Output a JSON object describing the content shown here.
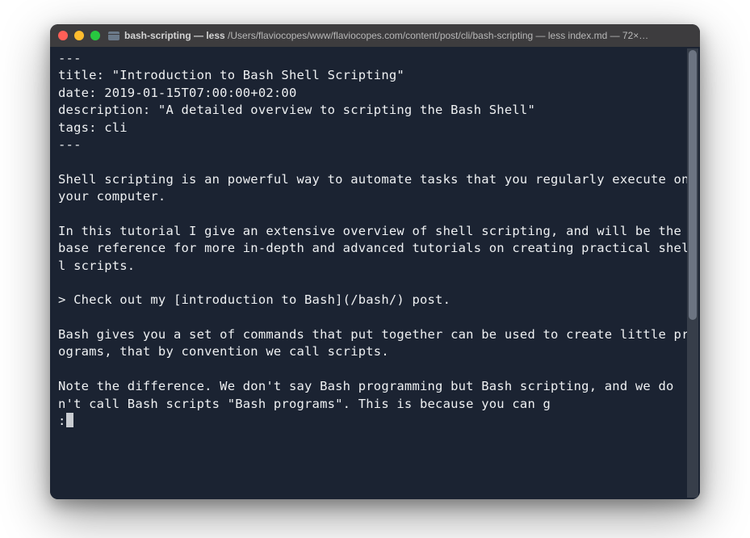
{
  "titlebar": {
    "process": "bash-scripting — less",
    "path": "/Users/flaviocopes/www/flaviocopes.com/content/post/cli/bash-scripting — less index.md — 72×…"
  },
  "content": {
    "lines": [
      "---",
      "title: \"Introduction to Bash Shell Scripting\"",
      "date: 2019-01-15T07:00:00+02:00",
      "description: \"A detailed overview to scripting the Bash Shell\"",
      "tags: cli",
      "---",
      "",
      "Shell scripting is an powerful way to automate tasks that you regularly execute on your computer.",
      "",
      "In this tutorial I give an extensive overview of shell scripting, and will be the base reference for more in-depth and advanced tutorials on creating practical shell scripts.",
      "",
      "> Check out my [introduction to Bash](/bash/) post.",
      "",
      "Bash gives you a set of commands that put together can be used to create little programs, that by convention we call scripts.",
      "",
      "Note the difference. We don't say Bash programming but Bash scripting, and we don't call Bash scripts \"Bash programs\". This is because you can g"
    ],
    "prompt": ":"
  }
}
